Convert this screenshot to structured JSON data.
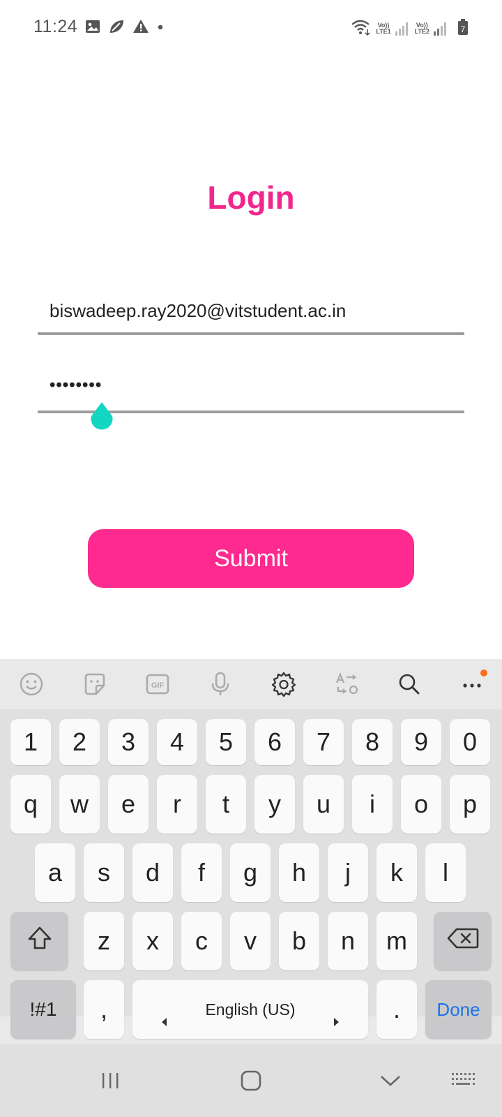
{
  "status_bar": {
    "time": "11:24",
    "sim1_label": "LTE1",
    "sim2_label": "LTE2",
    "volte1": "Vo))",
    "volte2": "Vo))",
    "battery_level": "7"
  },
  "login": {
    "title": "Login",
    "email_value": "biswadeep.ray2020@vitstudent.ac.in",
    "password_value": "••••••••",
    "submit_label": "Submit"
  },
  "colors": {
    "accent": "#F2278D",
    "button": "#FF2A8F",
    "cursor_handle": "#12D6C0"
  },
  "keyboard": {
    "toolbar_icons": [
      "emoji-icon",
      "sticker-icon",
      "gif-icon",
      "mic-icon",
      "settings-icon",
      "translate-icon",
      "search-icon",
      "more-icon"
    ],
    "gif_text": "GIF",
    "row_numbers": [
      "1",
      "2",
      "3",
      "4",
      "5",
      "6",
      "7",
      "8",
      "9",
      "0"
    ],
    "row_q": [
      "q",
      "w",
      "e",
      "r",
      "t",
      "y",
      "u",
      "i",
      "o",
      "p"
    ],
    "row_a": [
      "a",
      "s",
      "d",
      "f",
      "g",
      "h",
      "j",
      "k",
      "l"
    ],
    "row_z": [
      "z",
      "x",
      "c",
      "v",
      "b",
      "n",
      "m"
    ],
    "symbols_label": "!#1",
    "comma_label": ",",
    "space_label": "English (US)",
    "period_label": ".",
    "done_label": "Done"
  }
}
